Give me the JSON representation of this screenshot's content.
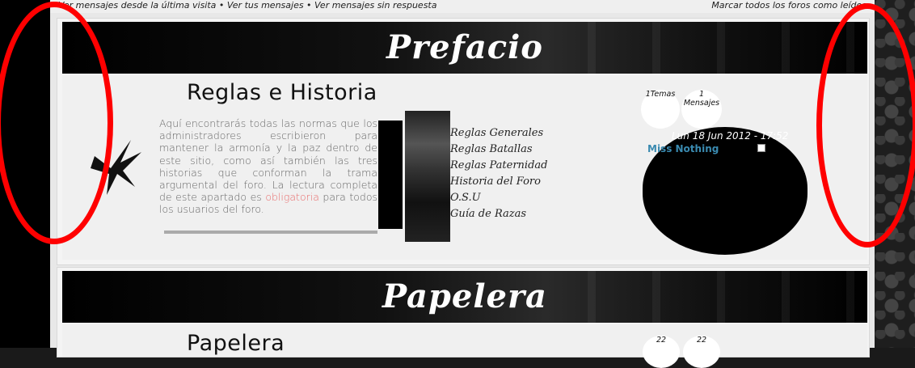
{
  "topbar": {
    "left_text": "Ver mensajes desde la última visita • Ver tus mensajes • Ver mensajes sin respuesta",
    "right_text": "Marcar todos los foros como leídos"
  },
  "categories": [
    {
      "banner_title": "Prefacio",
      "forum": {
        "title": "Reglas e Historia",
        "description_pre": "Aquí encontrarás todas las normas que los administradores escribieron para mantener la armonía y la paz dentro de este sitio, como así también las tres historias que conforman la trama argumental del foro. La lectura completa de este apartado es ",
        "description_emph": "obligatoria",
        "description_post": " para todos los usuarios del foro.",
        "subforums": [
          "Reglas Generales",
          "Reglas Batallas",
          "Reglas Paternidad",
          "Historia del Foro",
          "O.S.U",
          "Guía de Razas"
        ],
        "topics_count": "1",
        "topics_label": "Temas",
        "posts_count": "1",
        "posts_label": "Mensajes",
        "last_post_date": "Lun 18 Jun 2012 - 17:52",
        "last_post_user": "Miss Nothing"
      }
    },
    {
      "banner_title": "Papelera",
      "forum": {
        "title": "Papelera",
        "topics_count": "22",
        "posts_count": "22"
      }
    }
  ],
  "colors": {
    "annotation_red": "#ff0000",
    "link_blue": "#3a8ab0",
    "emphasis_red": "#e86a6a"
  }
}
